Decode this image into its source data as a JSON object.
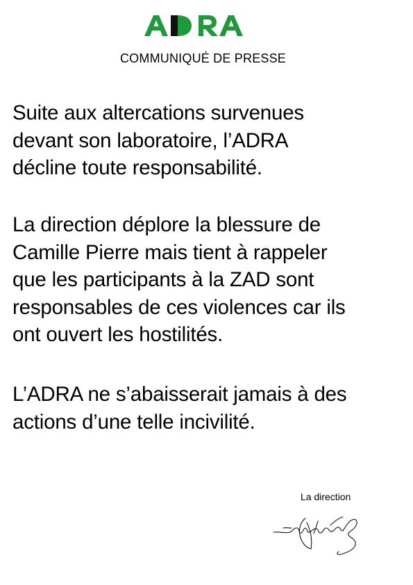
{
  "brand": {
    "logo_text": "ADRA",
    "logo_color": "#1f9a3a"
  },
  "header": {
    "title": "COMMUNIQUÉ DE PRESSE"
  },
  "paragraphs": [
    {
      "lines": [
        "Suite aux altercations survenues",
        "devant son laboratoire, l’ADRA",
        "décline toute responsabilité."
      ]
    },
    {
      "lines": [
        "La direction déplore la blessure de",
        "Camille Pierre mais tient à rappeler",
        "que les participants à la ZAD sont",
        "responsables de ces violences car ils",
        "ont ouvert les hostilités."
      ]
    },
    {
      "lines": [
        "L’ADRA ne s’abaisserait jamais à des",
        "actions d’une telle incivilité."
      ]
    }
  ],
  "footer": {
    "signoff": "La direction"
  }
}
